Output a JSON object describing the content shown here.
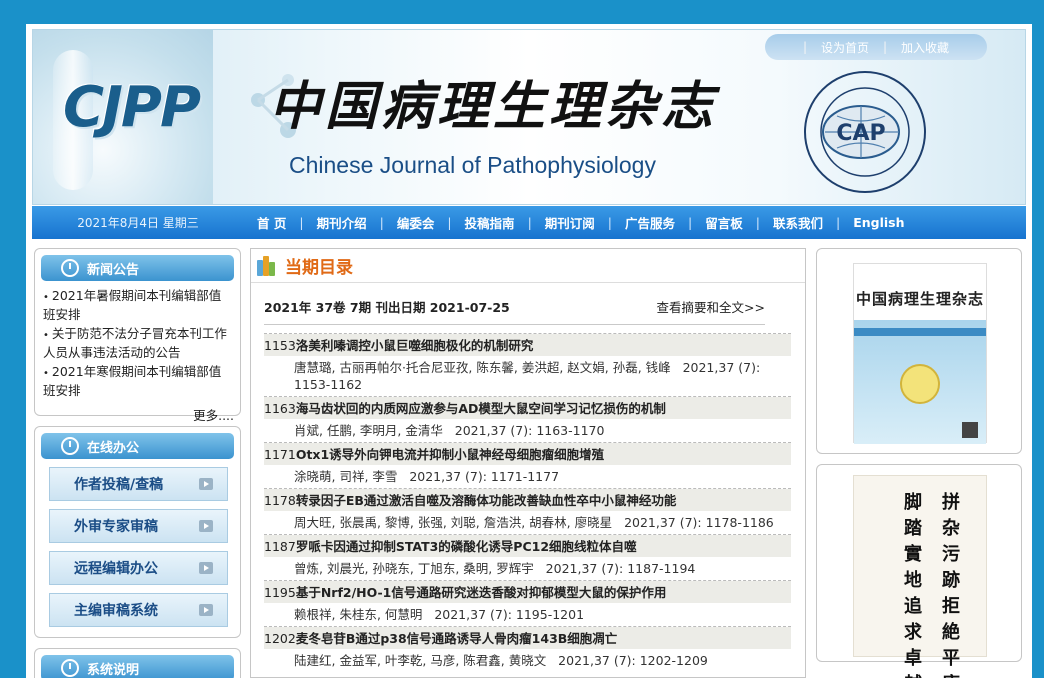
{
  "header": {
    "logo_text": "CJPP",
    "title_cn": "中国病理生理杂志",
    "title_en": "Chinese Journal of Pathophysiology",
    "top_links": [
      "设为首页",
      "加入收藏"
    ],
    "seal_text": "CAP"
  },
  "nav": {
    "date": "2021年8月4日  星期三",
    "items": [
      "首 页",
      "期刊介绍",
      "编委会",
      "投稿指南",
      "期刊订阅",
      "广告服务",
      "留言板",
      "联系我们",
      "English"
    ]
  },
  "news": {
    "title": "新闻公告",
    "items": [
      "2021年暑假期间本刊编辑部值班安排",
      "关于防范不法分子冒充本刊工作人员从事违法活动的公告",
      "2021年寒假期间本刊编辑部值班安排"
    ],
    "more": "更多...."
  },
  "office": {
    "title": "在线办公",
    "buttons": [
      "作者投稿/查稿",
      "外审专家审稿",
      "远程编辑办公",
      "主编审稿系统"
    ]
  },
  "system": {
    "title": "系统说明"
  },
  "main": {
    "title": "当期目录",
    "issue_info": "2021年 37卷 7期  刊出日期  2021-07-25",
    "full_text_link": "查看摘要和全文>>",
    "articles": [
      {
        "page": "1153",
        "title": "洛美利嗪调控小鼠巨噬细胞极化的机制研究",
        "authors": "唐慧璐, 古丽再帕尔·托合尼亚孜, 陈东馨, 姜洪超, 赵文娟, 孙磊, 钱峰",
        "citation": "2021,37 (7): 1153-1162"
      },
      {
        "page": "1163",
        "title": "海马齿状回的内质网应激参与AD模型大鼠空间学习记忆损伤的机制",
        "authors": "肖斌, 任鹏, 李明月, 金清华",
        "citation": "2021,37 (7): 1163-1170"
      },
      {
        "page": "1171",
        "title": "Otx1诱导外向钾电流并抑制小鼠神经母细胞瘤细胞增殖",
        "authors": "涂晓萌, 司祥, 李雪",
        "citation": "2021,37 (7): 1171-1177"
      },
      {
        "page": "1178",
        "title": "转录因子EB通过激活自噬及溶酶体功能改善缺血性卒中小鼠神经功能",
        "authors": "周大旺, 张晨禹, 黎博, 张强, 刘聪, 詹浩洪, 胡春林, 廖晓星",
        "citation": "2021,37 (7): 1178-1186"
      },
      {
        "page": "1187",
        "title": "罗哌卡因通过抑制STAT3的磷酸化诱导PC12细胞线粒体自噬",
        "authors": "曾炼, 刘晨光, 孙晓东, 丁旭东, 桑明, 罗辉宇",
        "citation": "2021,37 (7): 1187-1194"
      },
      {
        "page": "1195",
        "title": "基于Nrf2/HO-1信号通路研究迷迭香酸对抑郁模型大鼠的保护作用",
        "authors": "赖根祥, 朱桂东, 何慧明",
        "citation": "2021,37 (7): 1195-1201"
      },
      {
        "page": "1202",
        "title": "麦冬皂苷B通过p38信号通路诱导人骨肉瘤143B细胞凋亡",
        "authors": "陆建红, 金益军, 叶李乾, 马彦, 陈君鑫, 黄晓文",
        "citation": "2021,37 (7): 1202-1209"
      }
    ]
  },
  "right": {
    "cover_title": "中国病理生理杂志",
    "calligraphy_cols": [
      "拼杂污跡拒絶平庸",
      "脚踏實地追求卓越"
    ]
  },
  "colors": {
    "page_bg": "#1a91c9",
    "nav_bg": "#1773cf",
    "accent_orange": "#e06a16",
    "panel_head": "#3b93cf"
  }
}
